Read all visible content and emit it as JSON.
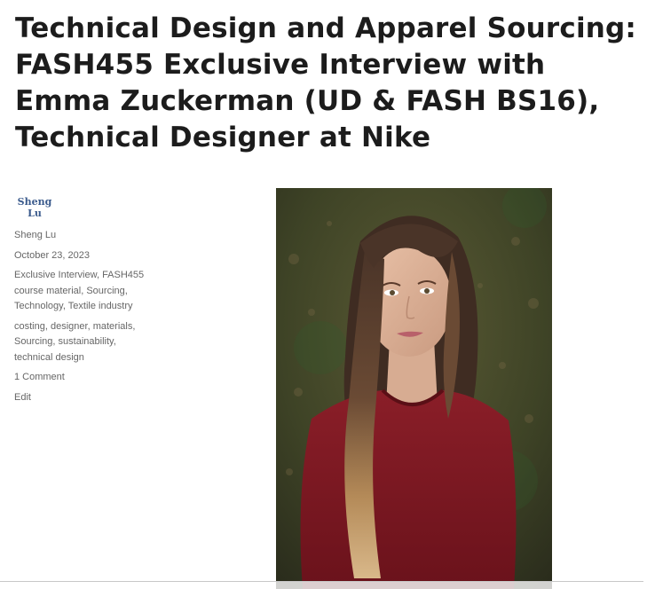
{
  "article": {
    "title": "Technical Design and Apparel Sourcing: FASH455 Exclusive Interview with Emma Zuckerman (UD & FASH BS16), Technical Designer at Nike"
  },
  "meta": {
    "author_logo": [
      "Sheng",
      "Lu"
    ],
    "author": "Sheng Lu",
    "date": "October 23, 2023",
    "categories": [
      "Exclusive Interview",
      "FASH455 course material",
      "Sourcing",
      "Technology",
      "Textile industry"
    ],
    "tags": [
      "costing",
      "designer",
      "materials",
      "Sourcing",
      "sustainability",
      "technical design"
    ],
    "comments": "1 Comment",
    "edit": "Edit"
  },
  "colors": {
    "link": "#666666",
    "logo": "#3a5a8c",
    "sweater": "#7a1822",
    "background_foliage": "#4a4f2c"
  },
  "image": {
    "icon": "portrait-photo"
  }
}
